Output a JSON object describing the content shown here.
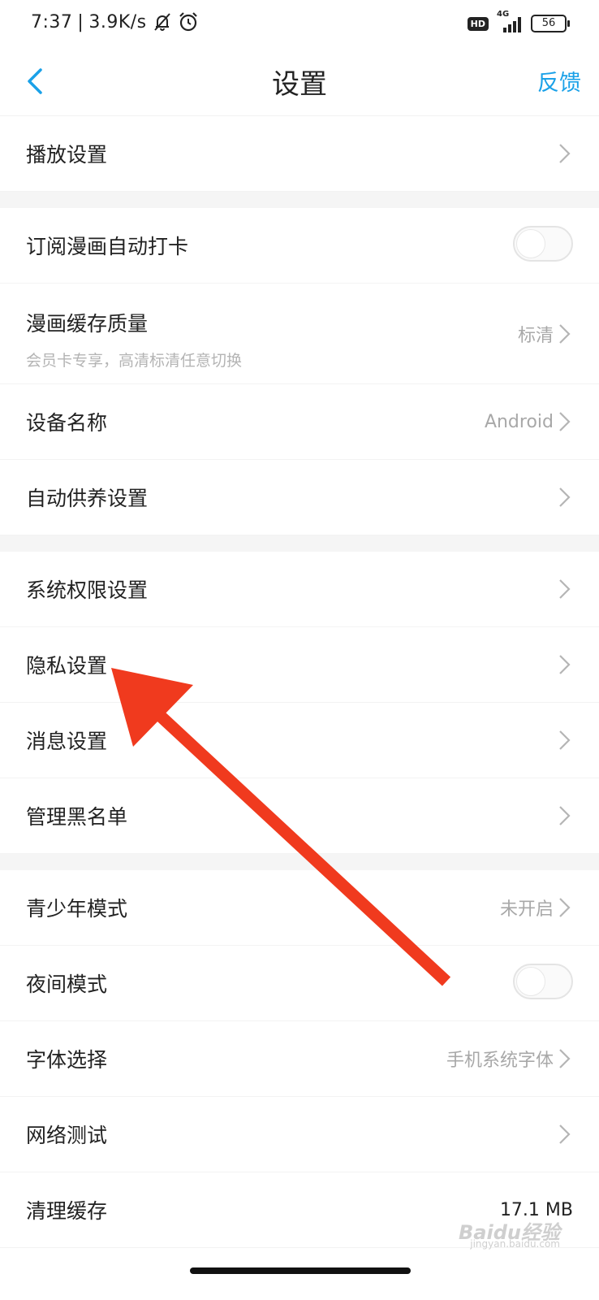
{
  "status_bar": {
    "time": "7:37",
    "separator": "|",
    "speed": "3.9K/s",
    "hd": "HD",
    "network": "4G",
    "battery": "56"
  },
  "header": {
    "title": "设置",
    "feedback": "反馈"
  },
  "rows": {
    "playback": {
      "label": "播放设置"
    },
    "auto_checkin": {
      "label": "订阅漫画自动打卡",
      "enabled": false
    },
    "cache_quality": {
      "label": "漫画缓存质量",
      "sub": "会员卡专享，高清标清任意切换",
      "value": "标清"
    },
    "device_name": {
      "label": "设备名称",
      "value": "Android"
    },
    "auto_feed": {
      "label": "自动供养设置"
    },
    "permissions": {
      "label": "系统权限设置"
    },
    "privacy": {
      "label": "隐私设置"
    },
    "messages": {
      "label": "消息设置"
    },
    "blacklist": {
      "label": "管理黑名单"
    },
    "youth_mode": {
      "label": "青少年模式",
      "value": "未开启"
    },
    "night_mode": {
      "label": "夜间模式",
      "enabled": false
    },
    "font": {
      "label": "字体选择",
      "value": "手机系统字体"
    },
    "network_test": {
      "label": "网络测试"
    },
    "clear_cache": {
      "label": "清理缓存",
      "value": "17.1 MB"
    }
  },
  "annotation": {
    "color": "#f03a1e"
  },
  "watermark": {
    "text": "Baidu经验",
    "sub": "jingyan.baidu.com"
  },
  "colors": {
    "accent": "#1aa1e8",
    "separator": "#f5f5f5"
  }
}
